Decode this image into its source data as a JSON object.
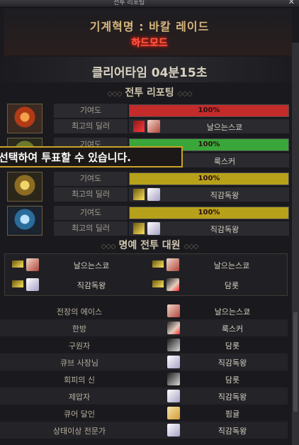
{
  "window": {
    "title": "전투 리포팅",
    "close_glyph": "✕"
  },
  "header": {
    "raid": "기계혁명 : 바칼 레이드",
    "mode": "하드모드"
  },
  "clear_time": "클리어타임 04분15초",
  "sections": {
    "report": "전투 리포팅",
    "honor": "명예 전투 대원"
  },
  "labels": {
    "contribution": "기여도",
    "best_dealer": "최고의 딜러"
  },
  "reports": [
    {
      "portrait_icon": "red-raid-emblem",
      "bar_color": "#c42b2b",
      "contribution": "100%",
      "dealer": "날으는스쿄",
      "weapon_icon": "red-weapon-icon"
    },
    {
      "portrait_icon": "green-raid-emblem",
      "bar_color": "#3aa63a",
      "contribution": "100%",
      "dealer": "룩스커",
      "weapon_icon": "green-weapon-icon"
    },
    {
      "portrait_icon": "gold-raid-emblem",
      "bar_color": "#b8a11a",
      "contribution": "100%",
      "dealer": "직감독왕",
      "weapon_icon": "gold-weapon-icon"
    },
    {
      "portrait_icon": "blue-raid-emblem",
      "bar_color": "#b8a11a",
      "contribution": "100%",
      "dealer": "직감독왕",
      "weapon_icon": "gold-weapon-icon"
    }
  ],
  "tooltip": "선택하여 투표할 수 있습니다.",
  "honor": [
    {
      "name": "날으는스쿄",
      "avatar": "a"
    },
    {
      "name": "날으는스쿄",
      "avatar": "a"
    },
    {
      "name": "직감독왕",
      "avatar": "b"
    },
    {
      "name": "담롯",
      "avatar": "c"
    }
  ],
  "awards": [
    {
      "title": "전장의 에이스",
      "name": "날으는스쿄"
    },
    {
      "title": "한방",
      "name": "룩스커"
    },
    {
      "title": "구원자",
      "name": "담롯"
    },
    {
      "title": "큐브 사장님",
      "name": "직감독왕"
    },
    {
      "title": "회피의 신",
      "name": "담롯"
    },
    {
      "title": "제압자",
      "name": "직감독왕"
    },
    {
      "title": "큐어 달인",
      "name": "핌귤"
    },
    {
      "title": "상태이상 전문가",
      "name": "직감독왕"
    }
  ]
}
